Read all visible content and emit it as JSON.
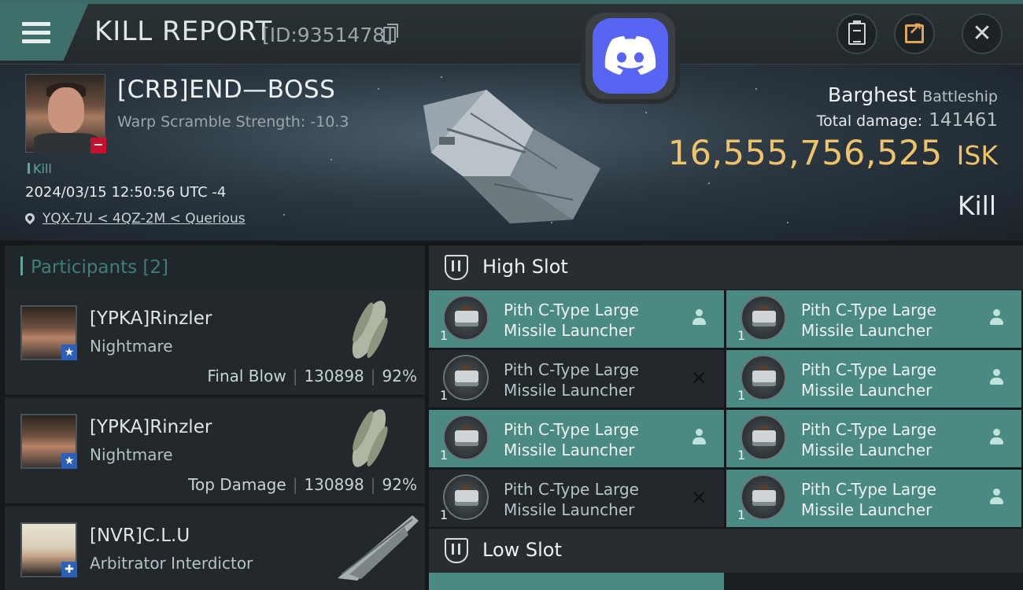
{
  "topbar": {
    "title": "KILL REPORT",
    "report_id": "[ID:9351478]",
    "buttons": {
      "menu": "menu-icon",
      "clipboard": "clipboard-icon",
      "share": "share-icon",
      "close": "close-icon"
    },
    "overlay": "discord-icon"
  },
  "victim": {
    "name": "[CRB]END—BOSS",
    "warp_scramble": "Warp Scramble Strength: -10.3",
    "tag": "Kill",
    "datetime": "2024/03/15 12:50:56 UTC -4",
    "location": "YQX-7U < 4QZ-2M < Querious",
    "ship_name": "Barghest",
    "ship_class": "Battleship",
    "total_damage_label": "Total damage:",
    "total_damage": "141461",
    "isk_value": "16,555,756,525",
    "isk_unit": "ISK",
    "result": "Kill"
  },
  "participants": {
    "title": "Participants [2]",
    "items": [
      {
        "name": "[YPKA]Rinzler",
        "ship": "Nightmare",
        "role": "Final Blow",
        "damage": "130898",
        "percent": "92%",
        "badge": "★"
      },
      {
        "name": "[YPKA]Rinzler",
        "ship": "Nightmare",
        "role": "Top Damage",
        "damage": "130898",
        "percent": "92%",
        "badge": "★"
      },
      {
        "name": "[NVR]C.L.U",
        "ship": "Arbitrator Interdictor",
        "badge": "✚"
      }
    ]
  },
  "fitting": {
    "high_slot_title": "High Slot",
    "low_slot_title": "Low Slot",
    "high_modules": [
      {
        "name": "Pith C-Type Large Missile Launcher",
        "qty": "1",
        "status": "dropped"
      },
      {
        "name": "Pith C-Type Large Missile Launcher",
        "qty": "1",
        "status": "dropped"
      },
      {
        "name": "Pith C-Type Large Missile Launcher",
        "qty": "1",
        "status": "destroyed",
        "status_mark": "✕"
      },
      {
        "name": "Pith C-Type Large Missile Launcher",
        "qty": "1",
        "status": "dropped"
      },
      {
        "name": "Pith C-Type Large Missile Launcher",
        "qty": "1",
        "status": "dropped"
      },
      {
        "name": "Pith C-Type Large Missile Launcher",
        "qty": "1",
        "status": "dropped"
      },
      {
        "name": "Pith C-Type Large Missile Launcher",
        "qty": "1",
        "status": "destroyed",
        "status_mark": "✕"
      },
      {
        "name": "Pith C-Type Large Missile Launcher",
        "qty": "1",
        "status": "dropped"
      }
    ]
  },
  "colors": {
    "accent": "#4b8a82",
    "isk": "#f0c36a",
    "destroyed_bg": "#22282b",
    "discord": "#5865f2"
  }
}
